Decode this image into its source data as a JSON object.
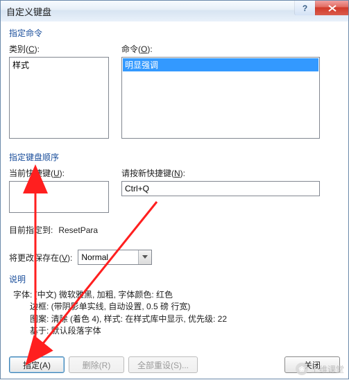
{
  "titlebar": {
    "title": "自定义键盘",
    "help_glyph": "?",
    "close_label": "close"
  },
  "specify_command": {
    "heading": "指定命令",
    "categories_label_pre": "类别(",
    "categories_label_key": "C",
    "categories_label_post": "):",
    "categories_items": [
      "样式"
    ],
    "commands_label_pre": "命令(",
    "commands_label_key": "O",
    "commands_label_post": "):",
    "commands_items": [
      "明显强调"
    ]
  },
  "key_sequence": {
    "heading": "指定键盘顺序",
    "current_label_pre": "当前快捷键(",
    "current_label_key": "U",
    "current_label_post": "):",
    "new_label_pre": "请按新快捷键(",
    "new_label_key": "N",
    "new_label_post": "):",
    "new_key_value": "Ctrl+Q"
  },
  "assigned": {
    "label": "目前指定到:",
    "value": "ResetPara"
  },
  "save_in": {
    "label_pre": "将更改保存在(",
    "label_key": "V",
    "label_post": "):",
    "value": "Normal"
  },
  "description": {
    "heading": "说明",
    "line1": "字体: (中文) 微软雅黑, 加粗, 字体颜色: 红色",
    "line2": "边框: (带阴影单实线, 自动设置,  0.5 磅 行宽)",
    "line3": "图案: 清除 (着色 4), 样式: 在样式库中显示, 优先级: 22",
    "line4": "基于: 默认段落字体"
  },
  "buttons": {
    "assign": "指定(A)",
    "remove": "删除(R)",
    "reset_all": "全部重设(S)...",
    "close": "关闭"
  },
  "watermark": {
    "text": "上维课堂"
  }
}
